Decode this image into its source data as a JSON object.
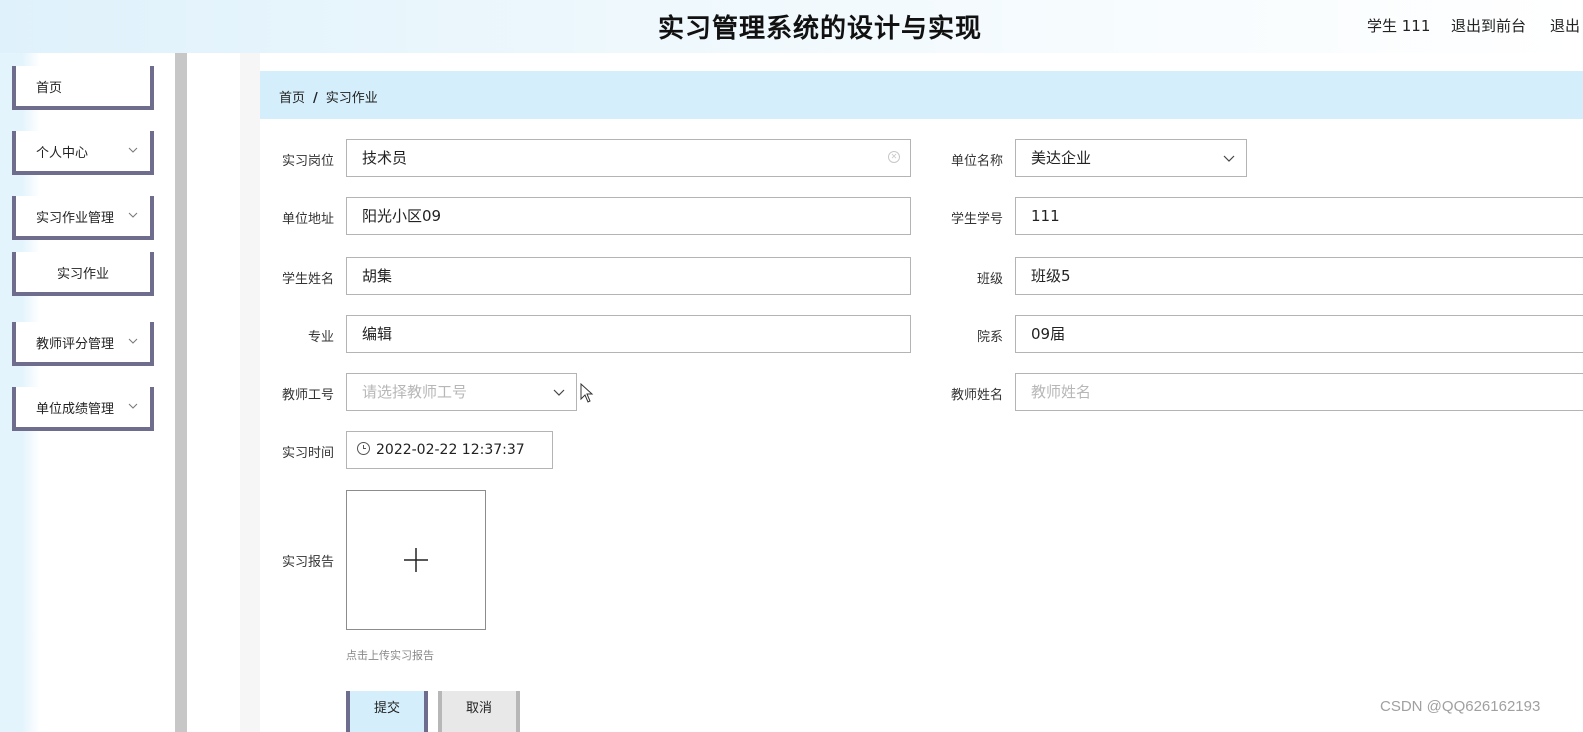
{
  "header": {
    "title": "实习管理系统的设计与实现",
    "user": "学生 111",
    "exit_front": "退出到前台",
    "exit_system": "退出"
  },
  "sidebar": {
    "items": [
      {
        "label": "首页",
        "icon": ""
      },
      {
        "label": "个人中心",
        "icon": "chevron-down-icon"
      },
      {
        "label": "实习作业管理",
        "icon": "chevron-down-icon"
      },
      {
        "label": "实习作业",
        "icon": ""
      },
      {
        "label": "教师评分管理",
        "icon": "chevron-down-icon"
      },
      {
        "label": "单位成绩管理",
        "icon": "chevron-down-icon"
      }
    ]
  },
  "breadcrumb": {
    "home": "首页",
    "separator": "/",
    "current": "实习作业"
  },
  "form": {
    "position_label": "实习岗位",
    "position_value": "技术员",
    "company_label": "单位名称",
    "company_value": "美达企业",
    "address_label": "单位地址",
    "address_value": "阳光小区09",
    "student_no_label": "学生学号",
    "student_no_value": "111",
    "student_name_label": "学生姓名",
    "student_name_value": "胡集",
    "class_label": "班级",
    "class_value": "班级5",
    "major_label": "专业",
    "major_value": "编辑",
    "department_label": "院系",
    "department_value": "09届",
    "teacher_no_label": "教师工号",
    "teacher_no_placeholder": "请选择教师工号",
    "teacher_name_label": "教师姓名",
    "teacher_name_placeholder": "教师姓名",
    "time_label": "实习时间",
    "time_value": "2022-02-22 12:37:37",
    "report_label": "实习报告",
    "report_hint": "点击上传实习报告"
  },
  "buttons": {
    "submit": "提交",
    "cancel": "取消"
  },
  "watermark": "CSDN @QQ626162193",
  "colors": {
    "accent_light": "#d4eefb",
    "menu_border": "#6e6d8e"
  }
}
